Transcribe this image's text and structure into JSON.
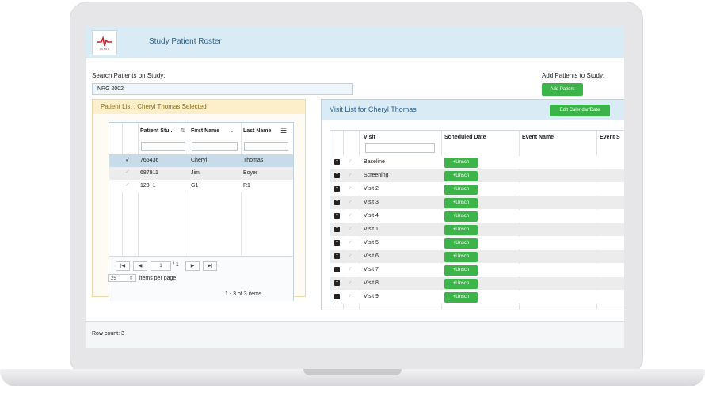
{
  "app": {
    "title": "Study Patient Roster",
    "logo_text": "ANTRS"
  },
  "search": {
    "label": "Search Patients on Study:",
    "value": "NRG 2002"
  },
  "add": {
    "label": "Add Patients to Study:",
    "button": "Add Patient"
  },
  "patient_list": {
    "title": "Patient List : Cheryl Thomas Selected",
    "columns": [
      "Patient Stu...",
      "First Name",
      "Last Name"
    ],
    "rows": [
      {
        "id": "765436",
        "first": "Cheryl",
        "last": "Thomas"
      },
      {
        "id": "687911",
        "first": "Jim",
        "last": "Boyer"
      },
      {
        "id": "123_1",
        "first": "G1",
        "last": "R1"
      }
    ],
    "pager": {
      "page": "1",
      "of": "/ 1",
      "page_size": "25",
      "items_per_page": "items per page",
      "summary": "1 - 3 of 3 items"
    }
  },
  "visit_list": {
    "title": "Visit List for Cheryl Thomas",
    "edit_button": "Edit Calendar/Date",
    "columns": [
      "Visit",
      "Scheduled Date",
      "Event Name",
      "Event S"
    ],
    "unsch_label": "+Unsch",
    "rows": [
      "Baseline",
      "Screening",
      "Visit 2",
      "Visit 3",
      "Visit 4",
      "Visit 1",
      "Visit 5",
      "Visit 6",
      "Visit 7",
      "Visit 8",
      "Visit 9"
    ]
  },
  "footer": {
    "row_count": "Row count: 3"
  }
}
